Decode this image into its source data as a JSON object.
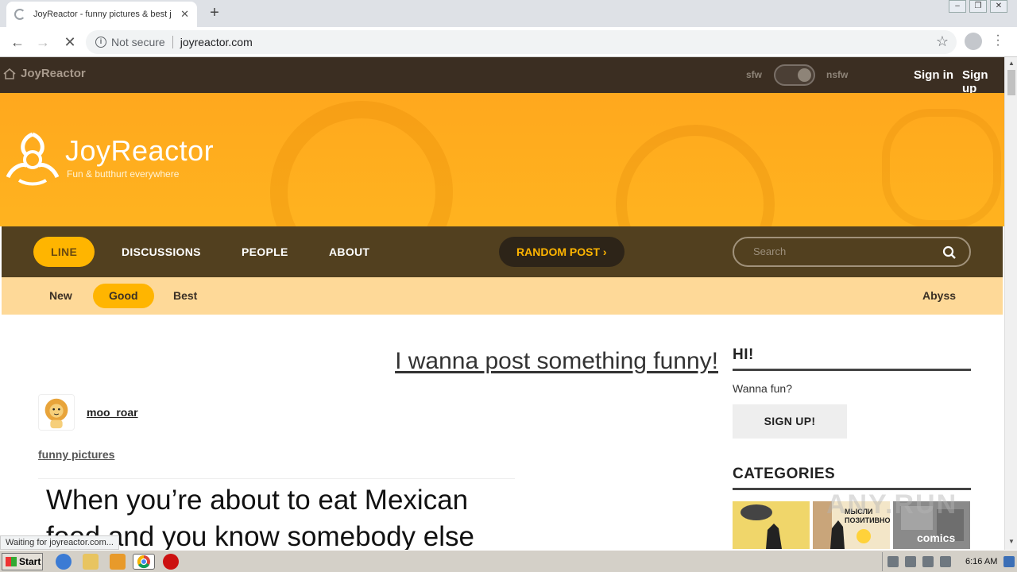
{
  "browser": {
    "tab_title": "JoyReactor - funny pictures & best j",
    "tab_close": "✕",
    "new_tab": "+",
    "security_label": "Not secure",
    "url": "joyreactor.com",
    "status_text": "Waiting for joyreactor.com..."
  },
  "site": {
    "home_label": "JoyReactor",
    "sfw_label": "sfw",
    "nsfw_label": "nsfw",
    "nsfw_enabled": true,
    "signin_label": "Sign in",
    "signup_label": "Sign up",
    "logo_title": "JoyReactor",
    "logo_tagline": "Fun & butthurt everywhere",
    "brand_color": "#ffb500"
  },
  "mainnav": {
    "items": [
      {
        "label": "LINE",
        "active": true
      },
      {
        "label": "DISCUSSIONS",
        "active": false
      },
      {
        "label": "PEOPLE",
        "active": false
      },
      {
        "label": "ABOUT",
        "active": false
      }
    ],
    "random_label": "RANDOM POST  ›",
    "search_placeholder": "Search"
  },
  "subnav": {
    "items": [
      {
        "label": "New",
        "active": false
      },
      {
        "label": "Good",
        "active": true
      },
      {
        "label": "Best",
        "active": false
      }
    ],
    "abyss_label": "Abyss"
  },
  "post": {
    "cta": "I wanna post something funny!",
    "author": "moo_roar",
    "tag": "funny pictures",
    "image_text_line1": "When you’re about to eat Mexican",
    "image_text_line2": "food and you know somebody else"
  },
  "sidebar": {
    "greeting": "HI!",
    "prompt": "Wanna fun?",
    "signup_button": "SIGN UP!",
    "categories_heading": "CATEGORIES",
    "category_comics": "comics",
    "category_thumb_text": "МЫСЛИ ПОЗИТИВНО"
  },
  "taskbar": {
    "start_label": "Start",
    "clock": "6:16 AM"
  },
  "watermark": "ANY.RUN"
}
